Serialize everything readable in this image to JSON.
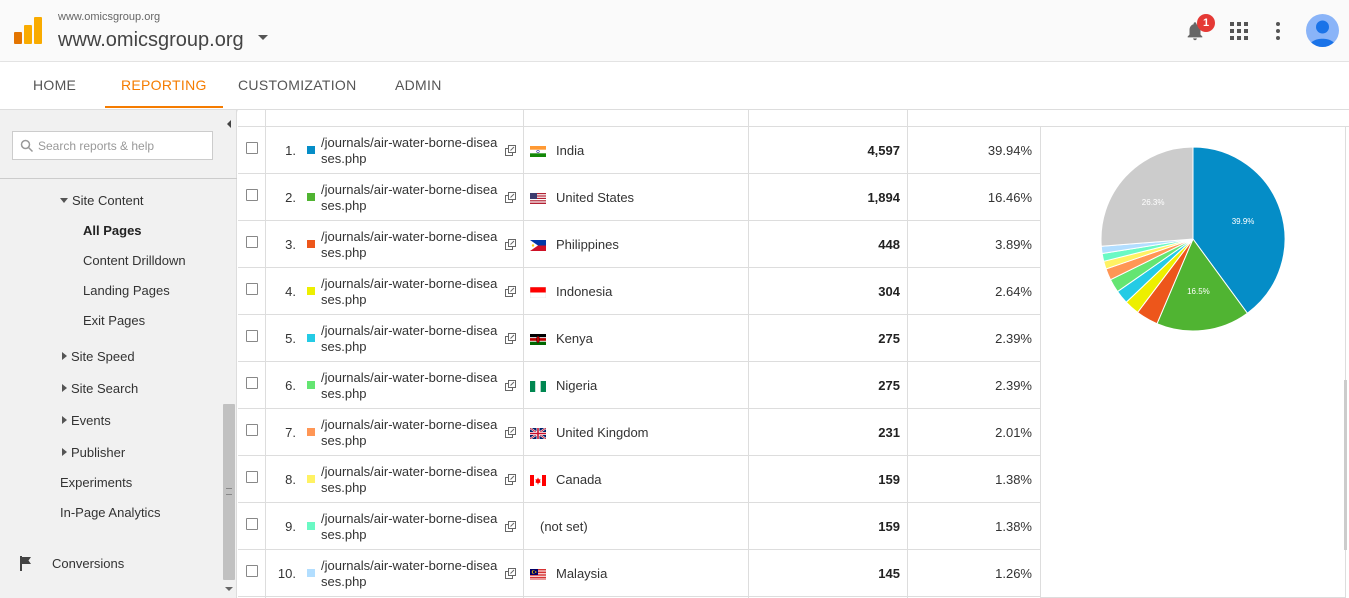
{
  "header": {
    "account_small": "www.omicsgroup.org",
    "account_name": "www.omicsgroup.org",
    "notification_count": "1",
    "colors": {
      "logo_orange": "#f9ab00",
      "logo_dark": "#e37400",
      "badge": "#e53935",
      "accent": "#f57c00"
    }
  },
  "nav": {
    "tabs": [
      {
        "label": "HOME",
        "active": false
      },
      {
        "label": "REPORTING",
        "active": true
      },
      {
        "label": "CUSTOMIZATION",
        "active": false
      },
      {
        "label": "ADMIN",
        "active": false
      }
    ]
  },
  "sidebar": {
    "search_placeholder": "Search reports & help",
    "items": [
      {
        "label": "Site Content",
        "expander": "down"
      },
      {
        "label": "All Pages",
        "selected": true
      },
      {
        "label": "Content Drilldown"
      },
      {
        "label": "Landing Pages"
      },
      {
        "label": "Exit Pages"
      },
      {
        "label": "Site Speed",
        "expander": "right"
      },
      {
        "label": "Site Search",
        "expander": "right"
      },
      {
        "label": "Events",
        "expander": "right"
      },
      {
        "label": "Publisher",
        "expander": "right"
      },
      {
        "label": "Experiments"
      },
      {
        "label": "In-Page Analytics"
      },
      {
        "label": "Conversions",
        "icon": "flag-icon"
      }
    ]
  },
  "table": {
    "rows": [
      {
        "rank": "1.",
        "color": "#058dc7",
        "page": "/journals/air-water-borne-diseases.php",
        "country": "India",
        "flag": "india",
        "value": "4,597",
        "percent": "39.94%"
      },
      {
        "rank": "2.",
        "color": "#50b432",
        "page": "/journals/air-water-borne-diseases.php",
        "country": "United States",
        "flag": "us",
        "value": "1,894",
        "percent": "16.46%"
      },
      {
        "rank": "3.",
        "color": "#ed561b",
        "page": "/journals/air-water-borne-diseases.php",
        "country": "Philippines",
        "flag": "philippines",
        "value": "448",
        "percent": "3.89%"
      },
      {
        "rank": "4.",
        "color": "#edef00",
        "page": "/journals/air-water-borne-diseases.php",
        "country": "Indonesia",
        "flag": "indonesia",
        "value": "304",
        "percent": "2.64%"
      },
      {
        "rank": "5.",
        "color": "#24cbe5",
        "page": "/journals/air-water-borne-diseases.php",
        "country": "Kenya",
        "flag": "kenya",
        "value": "275",
        "percent": "2.39%"
      },
      {
        "rank": "6.",
        "color": "#64e572",
        "page": "/journals/air-water-borne-diseases.php",
        "country": "Nigeria",
        "flag": "nigeria",
        "value": "275",
        "percent": "2.39%"
      },
      {
        "rank": "7.",
        "color": "#ff9655",
        "page": "/journals/air-water-borne-diseases.php",
        "country": "United Kingdom",
        "flag": "uk",
        "value": "231",
        "percent": "2.01%"
      },
      {
        "rank": "8.",
        "color": "#fff263",
        "page": "/journals/air-water-borne-diseases.php",
        "country": "Canada",
        "flag": "canada",
        "value": "159",
        "percent": "1.38%"
      },
      {
        "rank": "9.",
        "color": "#6af9c4",
        "page": "/journals/air-water-borne-diseases.php",
        "country": "(not set)",
        "flag": "",
        "value": "159",
        "percent": "1.38%"
      },
      {
        "rank": "10.",
        "color": "#b2deff",
        "page": "/journals/air-water-borne-diseases.php",
        "country": "Malaysia",
        "flag": "malaysia",
        "value": "145",
        "percent": "1.26%"
      }
    ]
  },
  "chart_data": {
    "type": "pie",
    "slices": [
      {
        "value": 39.94,
        "color": "#058dc7",
        "label": "39.9%"
      },
      {
        "value": 16.46,
        "color": "#50b432",
        "label": "16.5%"
      },
      {
        "value": 3.89,
        "color": "#ed561b",
        "label": ""
      },
      {
        "value": 2.64,
        "color": "#edef00",
        "label": ""
      },
      {
        "value": 2.39,
        "color": "#24cbe5",
        "label": ""
      },
      {
        "value": 2.39,
        "color": "#64e572",
        "label": ""
      },
      {
        "value": 2.01,
        "color": "#ff9655",
        "label": ""
      },
      {
        "value": 1.38,
        "color": "#fff263",
        "label": ""
      },
      {
        "value": 1.38,
        "color": "#6af9c4",
        "label": ""
      },
      {
        "value": 1.26,
        "color": "#b2deff",
        "label": ""
      },
      {
        "value": 26.26,
        "color": "#cccccc",
        "label": "26.3%"
      }
    ]
  }
}
